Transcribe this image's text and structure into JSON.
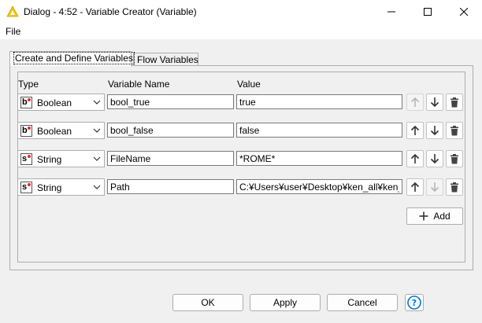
{
  "window": {
    "title": "Dialog - 4:52 - Variable Creator (Variable)"
  },
  "menu": {
    "file": "File"
  },
  "tabs": [
    {
      "label": "Create and Define Variables",
      "active": true
    },
    {
      "label": "Flow Variables",
      "active": false
    }
  ],
  "table": {
    "headers": {
      "type": "Type",
      "name": "Variable Name",
      "value": "Value"
    },
    "rows": [
      {
        "type_badge": "b",
        "type": "Boolean",
        "name": "bool_true",
        "value": "true",
        "up_enabled": false,
        "down_enabled": true
      },
      {
        "type_badge": "b",
        "type": "Boolean",
        "name": "bool_false",
        "value": "false",
        "up_enabled": true,
        "down_enabled": true
      },
      {
        "type_badge": "s",
        "type": "String",
        "name": "FileName",
        "value": "*ROME*",
        "up_enabled": true,
        "down_enabled": true
      },
      {
        "type_badge": "s",
        "type": "String",
        "name": "Path",
        "value": "C:¥Users¥user¥Desktop¥ken_all¥ken_all.",
        "up_enabled": true,
        "down_enabled": false
      }
    ]
  },
  "add_label": "Add",
  "buttons": {
    "ok": "OK",
    "apply": "Apply",
    "cancel": "Cancel"
  },
  "icons": {
    "app": "knime-warning-triangle-icon",
    "up": "arrow-up-icon",
    "down": "arrow-down-icon",
    "delete": "trash-icon",
    "add": "plus-icon",
    "help": "help-icon",
    "dropdown": "chevron-down-icon"
  },
  "colors": {
    "accent": "#0078d7",
    "app_icon": "#f5c518",
    "type_dot": "#d9312b"
  }
}
